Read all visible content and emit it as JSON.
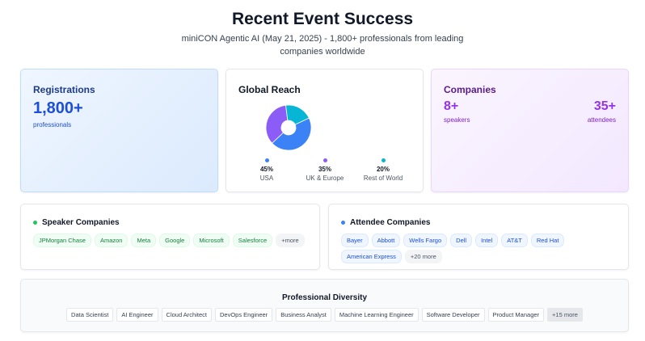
{
  "header": {
    "title": "Recent Event Success",
    "subtitle": "miniCON Agentic AI (May 21, 2025) - 1,800+ professionals from leading companies worldwide"
  },
  "registrations": {
    "title": "Registrations",
    "value": "1,800+",
    "label": "professionals"
  },
  "global_reach": {
    "title": "Global Reach",
    "segments": [
      {
        "name": "USA",
        "pct": "45%",
        "value": 45,
        "color": "#3b82f6"
      },
      {
        "name": "UK & Europe",
        "pct": "35%",
        "value": 35,
        "color": "#8b5cf6"
      },
      {
        "name": "Rest of World",
        "pct": "20%",
        "value": 20,
        "color": "#06b6d4"
      }
    ]
  },
  "companies": {
    "title": "Companies",
    "speakers_value": "8+",
    "speakers_label": "speakers",
    "attendees_value": "35+",
    "attendees_label": "attendees"
  },
  "speaker_companies": {
    "title": "Speaker Companies",
    "accent": "#22c55e",
    "items": [
      "JPMorgan Chase",
      "Amazon",
      "Meta",
      "Google",
      "Microsoft",
      "Salesforce"
    ],
    "more": "+more"
  },
  "attendee_companies": {
    "title": "Attendee Companies",
    "accent": "#3b82f6",
    "items": [
      "Bayer",
      "Abbott",
      "Wells Fargo",
      "Dell",
      "Intel",
      "AT&T",
      "Red Hat",
      "American Express"
    ],
    "more": "+20 more"
  },
  "diversity": {
    "title": "Professional Diversity",
    "items": [
      "Data Scientist",
      "AI Engineer",
      "Cloud Architect",
      "DevOps Engineer",
      "Business Analyst",
      "Machine Learning Engineer",
      "Software Developer",
      "Product Manager"
    ],
    "more": "+15 more"
  }
}
